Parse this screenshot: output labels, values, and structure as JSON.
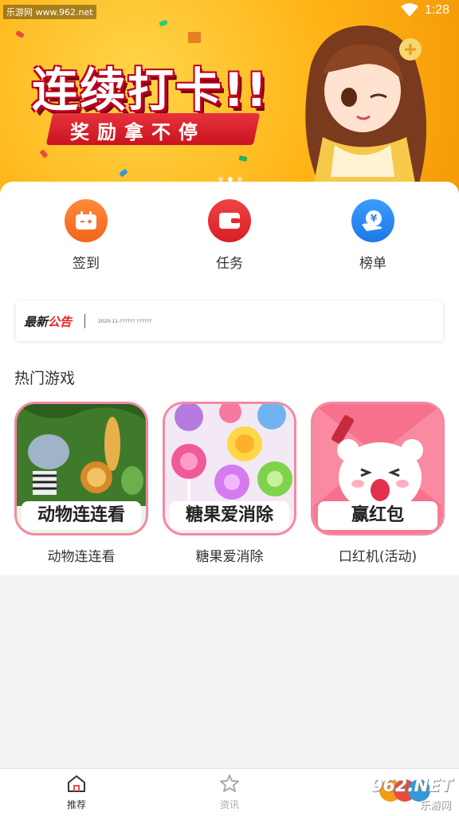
{
  "status_bar": {
    "watermark": "乐游网 www.962.net",
    "time": "1:28"
  },
  "banner": {
    "title": "连续打卡!!",
    "subtitle": "奖励拿不停",
    "slide_count": 3,
    "active_slide": 1
  },
  "quick_actions": [
    {
      "label": "签到",
      "icon": "calendar-icon",
      "color": "#f47228"
    },
    {
      "label": "任务",
      "icon": "wallet-icon",
      "color": "#e12a2e"
    },
    {
      "label": "榜单",
      "icon": "yen-coin-icon",
      "color": "#2a86ef"
    }
  ],
  "notice": {
    "tag_black": "最新",
    "tag_red": "公告",
    "text": "2020-11-??????  ??????"
  },
  "hot_games": {
    "title": "热门游戏",
    "items": [
      {
        "thumb_title": "动物连连看",
        "label": "动物连连看"
      },
      {
        "thumb_title": "糖果爱消除",
        "label": "糖果爱消除"
      },
      {
        "thumb_title": "赢红包",
        "label": "口红机(活动)"
      }
    ]
  },
  "bottom_nav": [
    {
      "label": "推荐",
      "icon": "home-icon",
      "active": true
    },
    {
      "label": "资讯",
      "icon": "star-icon",
      "active": false
    }
  ],
  "corner_watermark": {
    "text": "962.NET",
    "sub": "乐游网"
  }
}
